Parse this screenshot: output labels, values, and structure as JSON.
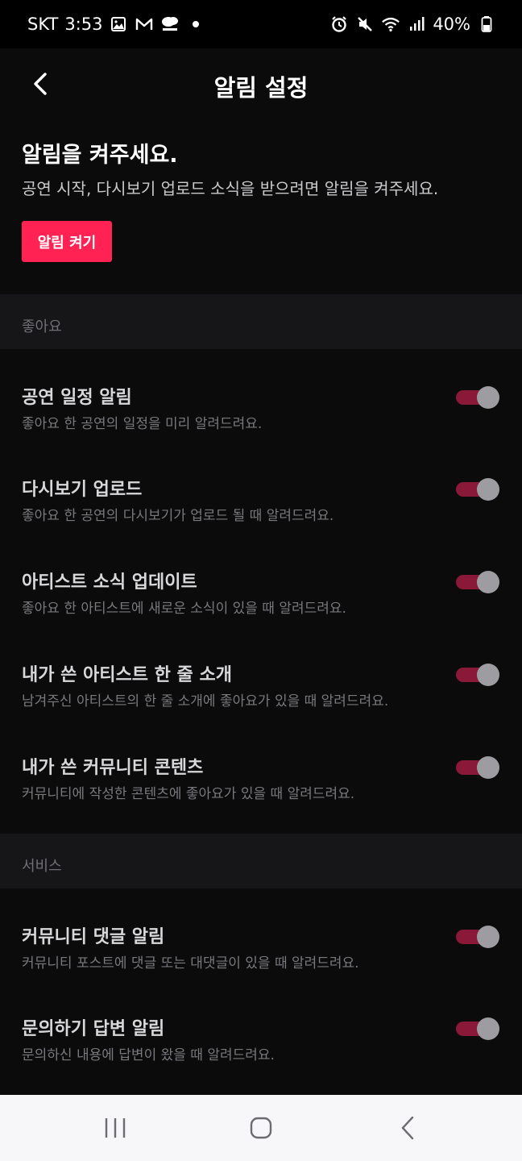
{
  "status_bar": {
    "carrier": "SKT",
    "time": "3:53",
    "battery": "40%"
  },
  "header": {
    "title": "알림 설정"
  },
  "notice": {
    "title": "알림을 켜주세요.",
    "description": "공연 시작, 다시보기 업로드 소식을 받으려면 알림을 켜주세요.",
    "button_label": "알림 켜기"
  },
  "sections": [
    {
      "label": "좋아요",
      "items": [
        {
          "title": "공연 일정 알림",
          "description": "좋아요 한 공연의 일정을 미리 알려드려요.",
          "enabled": true
        },
        {
          "title": "다시보기 업로드",
          "description": "좋아요 한 공연의 다시보기가 업로드 될 때 알려드려요.",
          "enabled": true
        },
        {
          "title": "아티스트 소식 업데이트",
          "description": "좋아요 한 아티스트에 새로운 소식이 있을 때 알려드려요.",
          "enabled": true
        },
        {
          "title": "내가 쓴 아티스트 한 줄 소개",
          "description": "남겨주신 아티스트의 한 줄 소개에 좋아요가 있을 때 알려드려요.",
          "enabled": true
        },
        {
          "title": "내가 쓴 커뮤니티 콘텐츠",
          "description": "커뮤니티에 작성한 콘텐츠에 좋아요가 있을 때 알려드려요.",
          "enabled": true
        }
      ]
    },
    {
      "label": "서비스",
      "items": [
        {
          "title": "커뮤니티 댓글 알림",
          "description": "커뮤니티 포스트에 댓글 또는 대댓글이 있을 때 알려드려요.",
          "enabled": true
        },
        {
          "title": "문의하기 답변 알림",
          "description": "문의하신 내용에 답변이 왔을 때 알려드려요.",
          "enabled": true
        }
      ]
    }
  ],
  "colors": {
    "accent": "#ff2253",
    "toggle_track_on": "#8a1838",
    "toggle_thumb": "#9d9da1",
    "background": "#0b0b0c",
    "section_header_bg": "#161618"
  },
  "icons": {
    "back": "chevron-left-icon",
    "nav_recent": "recent-apps-icon",
    "nav_home": "home-icon",
    "nav_back": "back-icon"
  }
}
